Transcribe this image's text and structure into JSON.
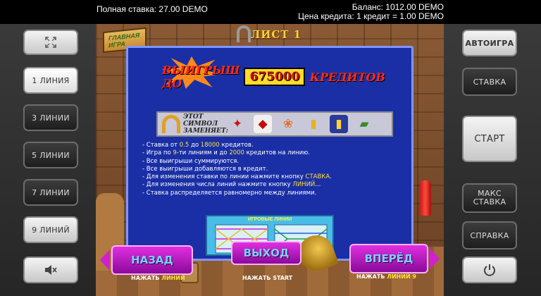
{
  "top": {
    "total_bet": "Полная ставка: 27.00 DEMO",
    "balance": "Баланс: 1012.00 DEMO",
    "credit_price": "Цена кредита: 1 кредит = 1.00 DEMO"
  },
  "left_buttons": {
    "fullscreen_icon": "fullscreen-icon",
    "line1": "1 ЛИНИЯ",
    "line3": "3 ЛИНИИ",
    "line5": "5 ЛИНИИ",
    "line7": "7 ЛИНИИ",
    "line9": "9 ЛИНИЙ",
    "mute_icon": "speaker-mute-icon"
  },
  "right_buttons": {
    "autoplay": "АВТОИГРА",
    "bet": "СТАВКА",
    "start": "СТАРТ",
    "max_bet_1": "МАКС",
    "max_bet_2": "СТАВКА",
    "help": "СПРАВКА",
    "power_icon": "power-icon"
  },
  "scene": {
    "sign_line1": "ГЛАВНАЯ",
    "sign_line2": "ИГРА",
    "page_title": "ЛИСТ 1",
    "banner_left": "ВЫИГРЫШ ДО",
    "banner_amount": "675000",
    "banner_right": "КРЕДИТОВ",
    "replace_label": "ЭТОТ СИМВОЛ ЗАМЕНЯЕТ:",
    "lines_caption": "ИГРОВЫЕ ЛИНИИ"
  },
  "rules": [
    {
      "pre": "- Ставка от ",
      "h1": "0.5",
      "mid": " до ",
      "h2": "18000",
      "post": " кредитов."
    },
    {
      "pre": "- Игра по ",
      "h1": "9",
      "mid": "-ти линиям и до ",
      "h2": "2000",
      "post": " кредитов на линию."
    },
    {
      "pre": "- Все выигрыши суммируются.",
      "h1": "",
      "mid": "",
      "h2": "",
      "post": ""
    },
    {
      "pre": "- Все выигрыши добавляются в кредит.",
      "h1": "",
      "mid": "",
      "h2": "",
      "post": ""
    },
    {
      "pre": "- Для изменения ставки по линии нажмите кнопку ",
      "h1": "СТАВКА",
      "mid": ".",
      "h2": "",
      "post": ""
    },
    {
      "pre": "- Для изменения числа линий нажмите кнопку ",
      "h1": "ЛИНИЙ",
      "mid": "...",
      "h2": "",
      "post": ""
    },
    {
      "pre": "- Ставка распределяется равномерно между линиями.",
      "h1": "",
      "mid": "",
      "h2": "",
      "post": ""
    }
  ],
  "nav": {
    "back": "НАЗАД",
    "exit": "ВЫХОД",
    "forward": "ВПЕРЁД",
    "hint_back_pre": "НАЖАТЬ ",
    "hint_back_key": "ЛИНИЙ",
    "hint_exit": "НАЖАТЬ START",
    "hint_fwd_pre": "НАЖАТЬ ",
    "hint_fwd_key": "ЛИНИЙ 9"
  },
  "colors": {
    "panel": "#1a2fa6",
    "highlight": "#ffe23a",
    "nav_button": "#c020c8"
  }
}
